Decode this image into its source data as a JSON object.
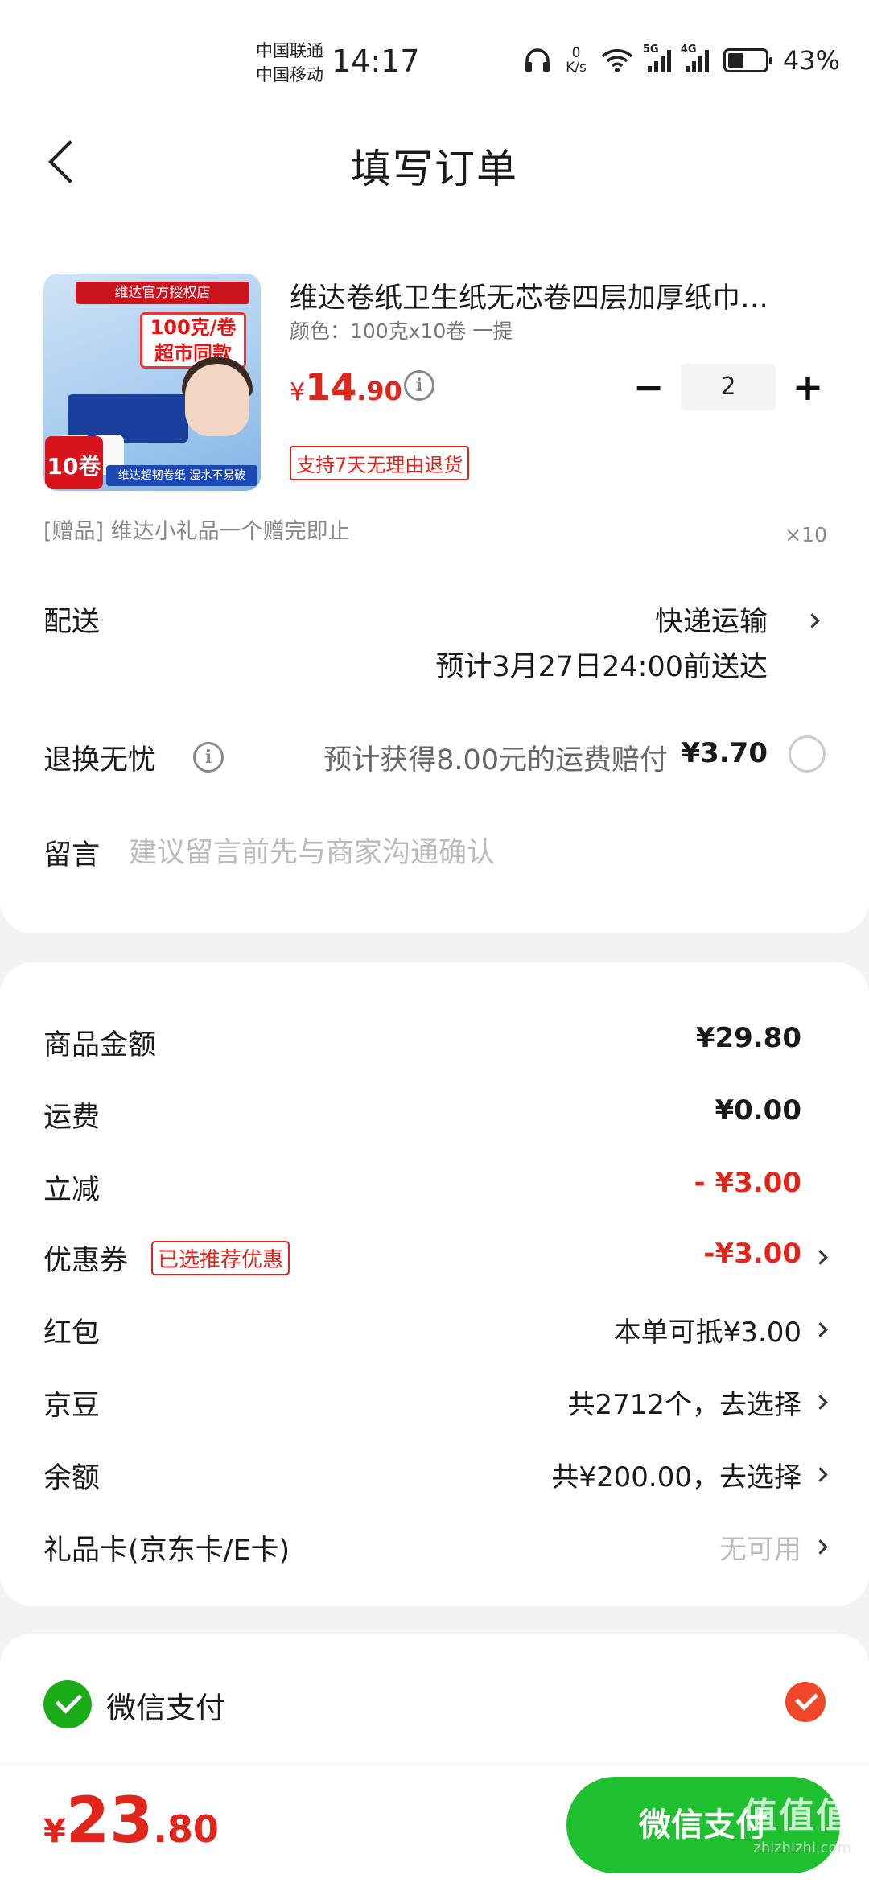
{
  "status_bar": {
    "carrier_1": "中国联通",
    "carrier_2": "中国移动",
    "time": "14:17",
    "net_speed_value": "0",
    "net_speed_unit": "K/s",
    "sig1_label": "5G",
    "sig2_label": "4G",
    "battery_level": 0.43,
    "battery_percent": "43%"
  },
  "header": {
    "title": "填写订单"
  },
  "product": {
    "image_badge": "维达官方授权店",
    "image_promo": "100克/卷 超市同款",
    "image_rolls": "10卷",
    "image_strip": "维达超韧卷纸 湿水不易破",
    "title": "维达卷纸卫生纸无芯卷四层加厚纸巾…",
    "spec": "颜色：100克x10卷 一提",
    "price_currency": "¥",
    "price_int": "14",
    "price_dec": ".90",
    "quantity": "2",
    "return_tag": "支持7天无理由退货"
  },
  "gift": {
    "text": "[赠品]   维达小礼品一个赠完即止",
    "qty": "×10"
  },
  "delivery": {
    "label": "配送",
    "method": "快递运输",
    "eta": "预计3月27日24:00前送达"
  },
  "insurance": {
    "label": "退换无忧",
    "text": "预计获得8.00元的运费赔付",
    "price": "¥3.70"
  },
  "message": {
    "label": "留言",
    "placeholder": "建议留言前先与商家沟通确认"
  },
  "fees": [
    {
      "label": "商品金额",
      "value": "¥29.80"
    },
    {
      "label": "运费",
      "value": "¥0.00"
    },
    {
      "label": "立减",
      "value": "- ¥3.00"
    },
    {
      "label": "优惠券",
      "tag": "已选推荐优惠",
      "value": "-¥3.00"
    },
    {
      "label": "红包",
      "value": "本单可抵¥3.00"
    },
    {
      "label": "京豆",
      "value": "共2712个，去选择"
    },
    {
      "label": "余额",
      "value": "共¥200.00，去选择"
    },
    {
      "label": "礼品卡(京东卡/E卡)",
      "value": "无可用"
    }
  ],
  "payment": {
    "method": "微信支付",
    "total_currency": "¥",
    "total_int": "23",
    "total_dec": ".80",
    "button": "微信支付"
  },
  "watermark": {
    "brand": "值值值",
    "site": "zhizhizhi.com"
  },
  "colors": {
    "accent_red": "#e1251b",
    "wechat_green": "#1ec030",
    "check_orange": "#f0472b"
  }
}
